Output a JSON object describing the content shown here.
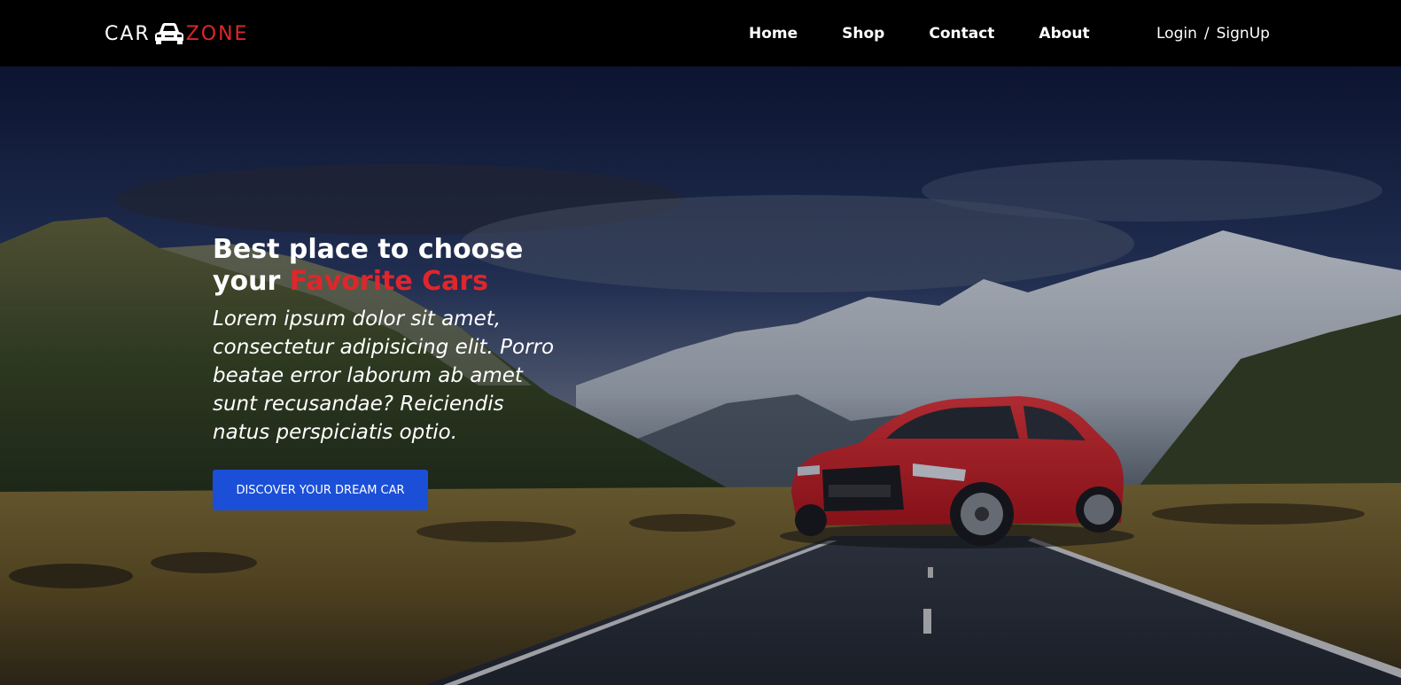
{
  "brand": {
    "part_a": "CAR",
    "part_b": "ZONE",
    "icon": "car-icon"
  },
  "nav": {
    "items": [
      {
        "label": "Home"
      },
      {
        "label": "Shop"
      },
      {
        "label": "Contact"
      },
      {
        "label": "About"
      }
    ],
    "login": "Login",
    "separator": "/",
    "signup": "SignUp"
  },
  "hero": {
    "headline_line1": "Best place to choose",
    "headline_line2_prefix": "your ",
    "headline_accent": "Favorite Cars",
    "subtext": "Lorem ipsum dolor sit amet, consectetur adipisicing elit. Porro beatae error laborum ab amet sunt recusandae? Reiciendis natus perspiciatis optio.",
    "cta_label": "DISCOVER YOUR DREAM CAR"
  },
  "colors": {
    "accent_red": "#e0262b",
    "cta_blue": "#1b4fd8",
    "nav_bg": "#000000"
  }
}
